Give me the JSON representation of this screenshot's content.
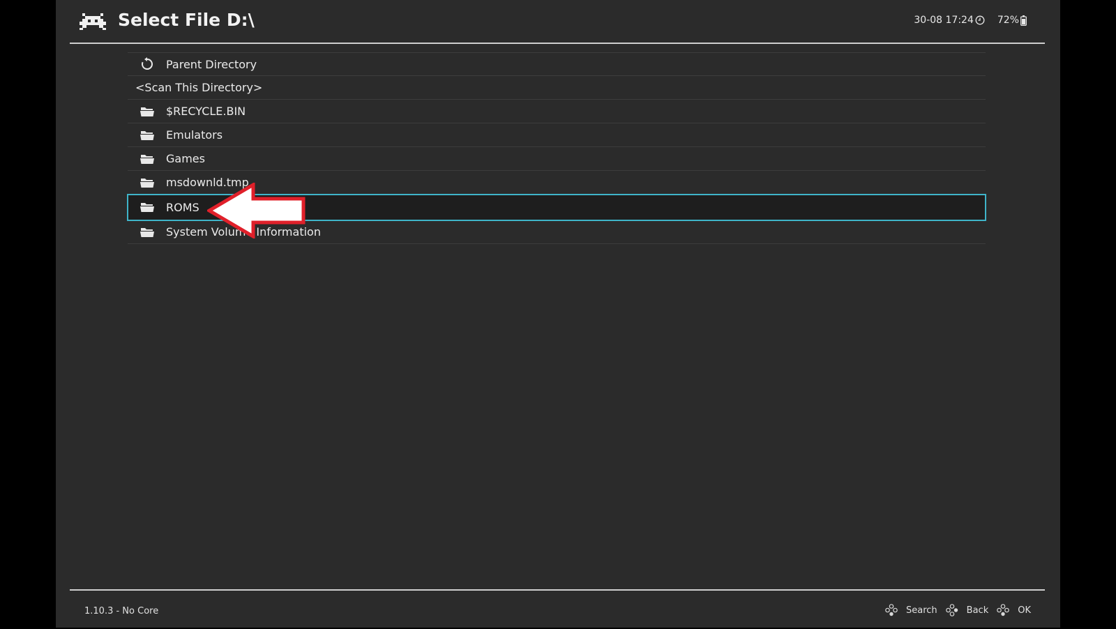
{
  "header": {
    "title": "Select File D:\\",
    "logo_icon": "retroarch-invader-icon",
    "datetime": "30-08 17:24",
    "battery": "72%"
  },
  "list": {
    "items": [
      {
        "label": "Parent Directory",
        "icon": "parent-directory-icon",
        "type": "parent"
      },
      {
        "label": "<Scan This Directory>",
        "icon": "",
        "type": "scan"
      },
      {
        "label": "$RECYCLE.BIN",
        "icon": "folder-icon",
        "type": "folder"
      },
      {
        "label": "Emulators",
        "icon": "folder-icon",
        "type": "folder"
      },
      {
        "label": "Games",
        "icon": "folder-icon",
        "type": "folder"
      },
      {
        "label": "msdownld.tmp",
        "icon": "folder-icon",
        "type": "folder"
      },
      {
        "label": "ROMS",
        "icon": "folder-icon",
        "type": "folder",
        "selected": true
      },
      {
        "label": "System Volume Information",
        "icon": "folder-icon",
        "type": "folder"
      }
    ]
  },
  "footer": {
    "version": "1.10.3 - No Core",
    "hints": [
      {
        "label": "Search",
        "icon": "gamepad-button-icon"
      },
      {
        "label": "Back",
        "icon": "gamepad-button-icon"
      },
      {
        "label": "OK",
        "icon": "gamepad-button-icon"
      }
    ]
  },
  "colors": {
    "background": "#2b2b2b",
    "selection_border": "#3fb4c9",
    "annotation_arrow": "#e0202a"
  }
}
